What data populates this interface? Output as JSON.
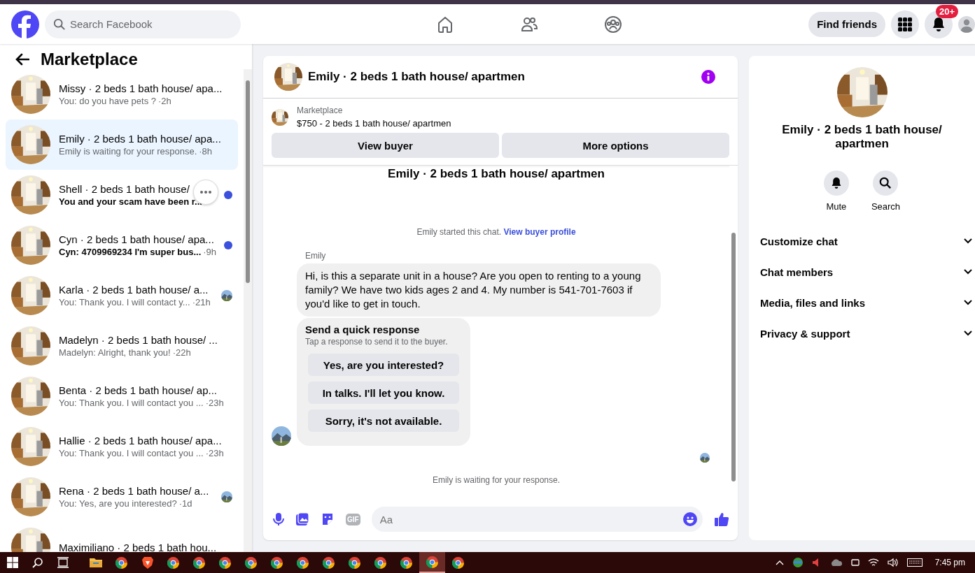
{
  "topbar": {
    "search": {
      "placeholder": "Search Facebook"
    },
    "nav": [
      {
        "kind": "home",
        "selected": false
      },
      {
        "kind": "friends",
        "selected": false
      },
      {
        "kind": "groups",
        "selected": false
      }
    ],
    "find_friends": "Find friends",
    "notification_badge": "20+"
  },
  "sidebar": {
    "title": "Marketplace",
    "conversations": [
      {
        "title": "Missy · 2 beds 1 bath house/ apa...",
        "preview": "You: do you have pets ?",
        "time": "·2h",
        "unread": false,
        "selected": false,
        "hovered": false,
        "seen": false
      },
      {
        "title": "Emily · 2 beds 1 bath house/ apa...",
        "preview": "Emily is waiting for your response.",
        "time": "·8h",
        "unread": false,
        "selected": true,
        "hovered": false,
        "seen": false
      },
      {
        "title": "Shell · 2 beds 1 bath house/",
        "preview": "You and your scam have been r...",
        "unread": true,
        "selected": false,
        "hovered": true,
        "seen": false
      },
      {
        "title": "Cyn · 2 beds 1 bath house/ apa...",
        "preview": "Cyn: 4709969234 I'm super bus...",
        "time": "·9h",
        "unread": true,
        "selected": false,
        "hovered": false,
        "seen": false
      },
      {
        "title": "Karla · 2 beds 1 bath house/ a...",
        "preview": "You: Thank you. I will contact y...",
        "time": "·21h",
        "unread": false,
        "selected": false,
        "hovered": false,
        "seen": true
      },
      {
        "title": "Madelyn · 2 beds 1 bath house/ ...",
        "preview": "Madelyn: Alright, thank you!",
        "time": "·22h",
        "unread": false,
        "selected": false,
        "hovered": false,
        "seen": false
      },
      {
        "title": "Benta · 2 beds 1 bath house/ ap...",
        "preview": "You: Thank you. I will contact you ...",
        "time": "·23h",
        "unread": false,
        "selected": false,
        "hovered": false,
        "seen": false
      },
      {
        "title": "Hallie · 2 beds 1 bath house/ apa...",
        "preview": "You: Thank you. I will contact you ...",
        "time": "·23h",
        "unread": false,
        "selected": false,
        "hovered": false,
        "seen": false
      },
      {
        "title": "Rena · 2 beds 1 bath house/ a...",
        "preview": "You: Yes, are you interested?",
        "time": "·1d",
        "unread": false,
        "selected": false,
        "hovered": false,
        "seen": true
      },
      {
        "title": "Maximiliano · 2 beds 1 bath hou..."
      }
    ]
  },
  "chat": {
    "title": "Emily · 2 beds 1 bath house/ apartmen",
    "listing": {
      "source": "Marketplace",
      "text": "$750 - 2 beds 1 bath house/ apartmen"
    },
    "actions": [
      "View buyer",
      "More options"
    ],
    "heading": "Emily · 2 beds 1 bath house/ apartmen",
    "started_text": "Emily started this chat.",
    "started_link": "View buyer profile",
    "sender": "Emily",
    "message": "Hi, is this a separate unit in a house? Are you open to renting to a young family? We have two kids ages 2 and 4. My number is 541-701-7603 if you'd like to get in touch.",
    "quick_response": {
      "title": "Send a quick response",
      "hint": "Tap a response to send it to the buyer.",
      "options": [
        "Yes, are you interested?",
        "In talks. I'll let you know.",
        "Sorry, it's not available."
      ]
    },
    "status": "Emily is waiting for your response.",
    "composer": {
      "placeholder": "Aa",
      "gif_label": "GIF"
    }
  },
  "details": {
    "title": "Emily · 2 beds 1 bath house/ apartmen",
    "actions": [
      {
        "kind": "mute",
        "label": "Mute"
      },
      {
        "kind": "search",
        "label": "Search"
      }
    ],
    "sections": [
      {
        "label": "Customize chat",
        "expanded": false
      },
      {
        "label": "Chat members",
        "expanded": false
      },
      {
        "label": "Media, files and links",
        "expanded": false
      },
      {
        "label": "Privacy & support",
        "expanded": false
      }
    ]
  },
  "taskbar": {
    "apps": [
      {
        "kind": "folder",
        "active": false
      },
      {
        "kind": "chrome",
        "active": false
      },
      {
        "kind": "brave",
        "active": false
      },
      {
        "kind": "chrome",
        "active": false
      },
      {
        "kind": "chrome",
        "active": false
      },
      {
        "kind": "chrome",
        "active": false
      },
      {
        "kind": "chrome",
        "active": false
      },
      {
        "kind": "chrome",
        "active": false
      },
      {
        "kind": "chrome",
        "active": false
      },
      {
        "kind": "chrome",
        "active": false
      },
      {
        "kind": "chrome",
        "active": false
      },
      {
        "kind": "chrome",
        "active": false
      },
      {
        "kind": "chrome",
        "active": false
      },
      {
        "kind": "chrome",
        "active": true
      },
      {
        "kind": "chrome",
        "active": false
      }
    ],
    "time": "7:45 pm"
  }
}
